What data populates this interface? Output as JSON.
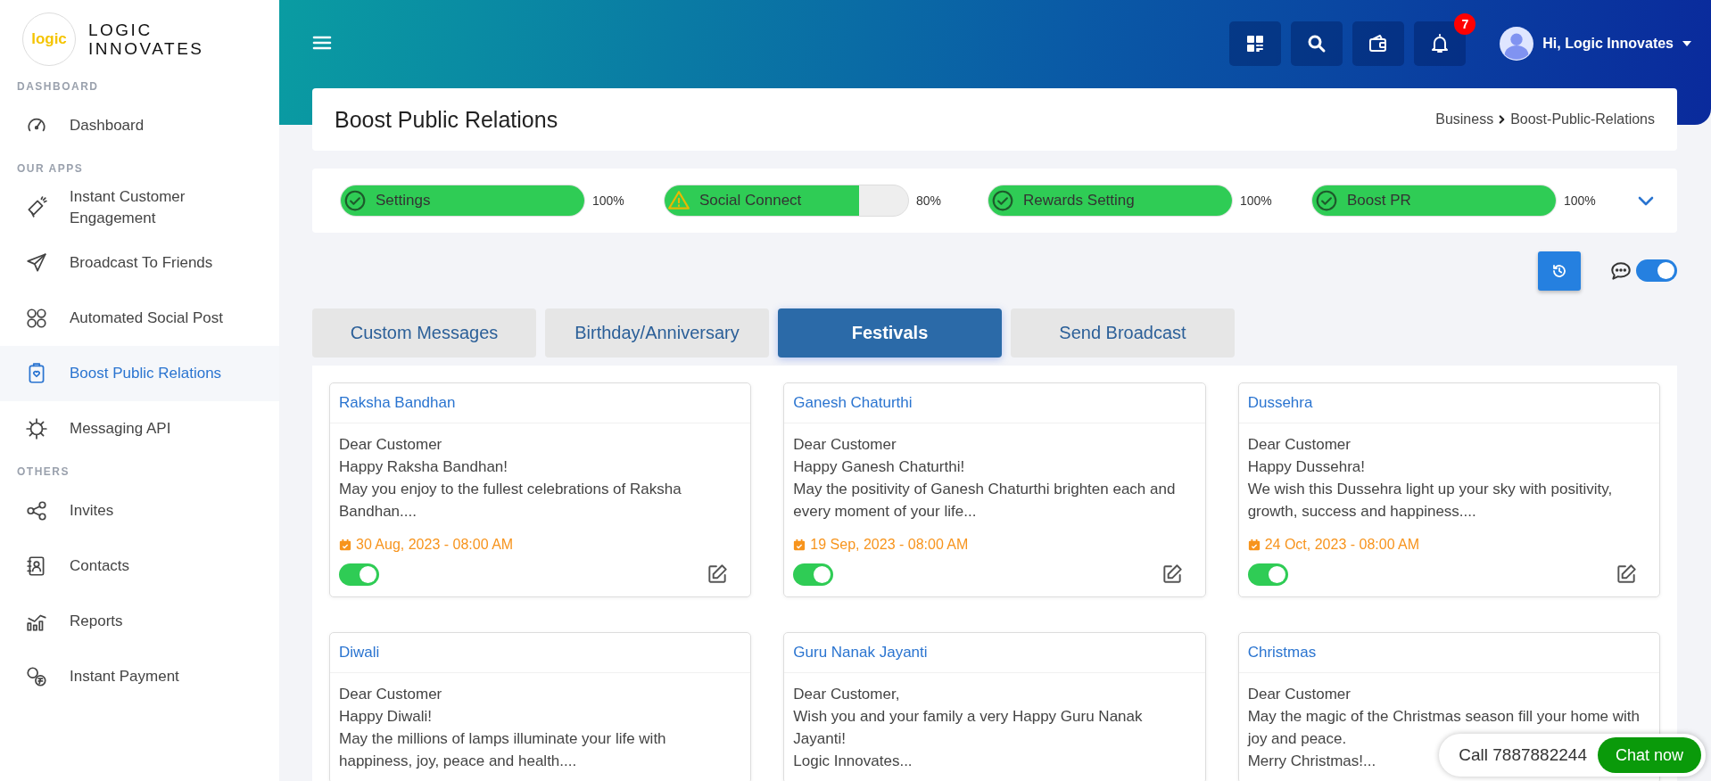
{
  "brand": {
    "logo_mark": "logic",
    "name_lines": [
      "LOGIC",
      "INNOVATES"
    ]
  },
  "sidebar": {
    "sections": [
      {
        "heading": "DASHBOARD",
        "items": [
          {
            "label": "Dashboard",
            "selected": false
          }
        ]
      },
      {
        "heading": "OUR APPS",
        "items": [
          {
            "label": "Instant Customer Engagement",
            "selected": false
          },
          {
            "label": "Broadcast To Friends",
            "selected": false
          },
          {
            "label": "Automated Social Post",
            "selected": false
          },
          {
            "label": "Boost Public Relations",
            "selected": true
          },
          {
            "label": "Messaging API",
            "selected": false
          }
        ]
      },
      {
        "heading": "OTHERS",
        "items": [
          {
            "label": "Invites",
            "selected": false
          },
          {
            "label": "Contacts",
            "selected": false
          },
          {
            "label": "Reports",
            "selected": false
          },
          {
            "label": "Instant Payment",
            "selected": false
          }
        ]
      }
    ]
  },
  "topbar": {
    "notification_count": "7",
    "user_greeting": "Hi, Logic Innovates"
  },
  "page": {
    "title": "Boost Public Relations",
    "breadcrumb": [
      "Business",
      "Boost-Public-Relations"
    ]
  },
  "progress": [
    {
      "label": "Settings",
      "kind": "complete",
      "level": 1,
      "reading": "100%"
    },
    {
      "label": "Social Connect",
      "kind": "warning",
      "level": 0.8,
      "reading": "80%"
    },
    {
      "label": "Rewards Setting",
      "kind": "complete",
      "level": 1,
      "reading": "100%"
    },
    {
      "label": "Boost PR",
      "kind": "complete",
      "level": 1,
      "reading": "100%"
    }
  ],
  "chat_toggle": {
    "on": true
  },
  "tabs": [
    {
      "label": "Custom Messages",
      "selected": false
    },
    {
      "label": "Birthday/Anniversary",
      "selected": false
    },
    {
      "label": "Festivals",
      "selected": true
    },
    {
      "label": "Send Broadcast",
      "selected": false
    }
  ],
  "cards": [
    {
      "title": "Raksha Bandhan",
      "lines": [
        "Dear Customer",
        "Happy Raksha Bandhan!",
        "May you enjoy to the fullest celebrations of Raksha Bandhan...."
      ],
      "date": "30 Aug, 2023 - 08:00 AM",
      "on": true
    },
    {
      "title": "Ganesh Chaturthi",
      "lines": [
        "Dear Customer",
        "Happy Ganesh Chaturthi!",
        "May the positivity of Ganesh Chaturthi brighten each and every moment of your life..."
      ],
      "date": "19 Sep, 2023 - 08:00 AM",
      "on": true
    },
    {
      "title": "Dussehra",
      "lines": [
        "Dear Customer",
        "Happy Dussehra!",
        "We wish this Dussehra light up your sky with positivity, growth, success and happiness...."
      ],
      "date": "24 Oct, 2023 - 08:00 AM",
      "on": true
    },
    {
      "title": "Diwali",
      "lines": [
        "Dear Customer",
        "Happy Diwali!",
        "May the millions of lamps illuminate your life with happiness, joy, peace and health...."
      ]
    },
    {
      "title": "Guru Nanak Jayanti",
      "lines": [
        "Dear Customer,",
        "Wish you and your family a very Happy Guru Nanak Jayanti!",
        "Logic Innovates..."
      ]
    },
    {
      "title": "Christmas",
      "lines": [
        "Dear Customer",
        "May the magic of the Christmas season fill your home with joy and peace.",
        "Merry Christmas!..."
      ]
    }
  ],
  "chat_widget": {
    "call_text": "Call 7887882244",
    "button": "Chat now"
  }
}
